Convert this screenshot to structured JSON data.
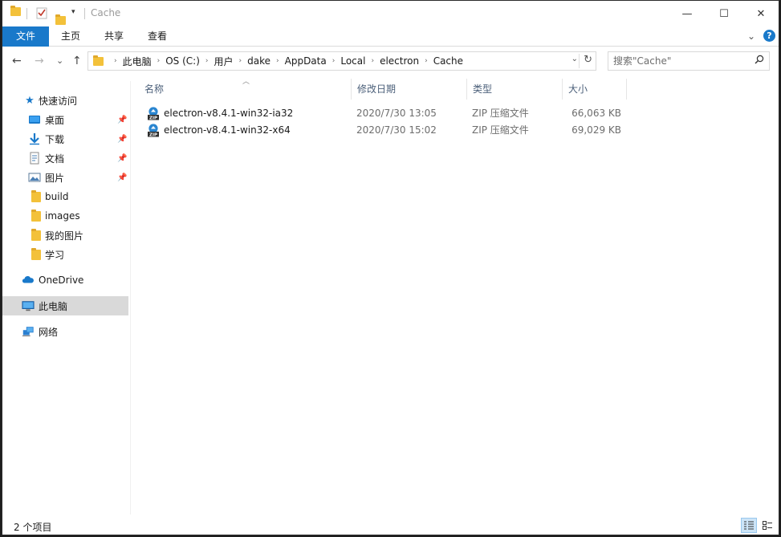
{
  "window": {
    "title": "Cache",
    "minimize": "—",
    "maximize": "☐",
    "close": "✕"
  },
  "ribbon": {
    "tabs": [
      "文件",
      "主页",
      "共享",
      "查看"
    ],
    "help": "?",
    "expand": "⌄"
  },
  "nav": {
    "back": "←",
    "forward": "→",
    "recent": "⌄",
    "up": "↑"
  },
  "address": {
    "crumbs": [
      "此电脑",
      "OS (C:)",
      "用户",
      "dake",
      "AppData",
      "Local",
      "electron",
      "Cache"
    ],
    "dropdown": "⌄",
    "refresh": "↻"
  },
  "search": {
    "placeholder": "搜索\"Cache\""
  },
  "sidebar": {
    "quick_access": "快速访问",
    "items": [
      {
        "label": "桌面",
        "pinned": true
      },
      {
        "label": "下载",
        "pinned": true
      },
      {
        "label": "文档",
        "pinned": true
      },
      {
        "label": "图片",
        "pinned": true
      },
      {
        "label": "build",
        "pinned": false
      },
      {
        "label": "images",
        "pinned": false
      },
      {
        "label": "我的图片",
        "pinned": false
      },
      {
        "label": "学习",
        "pinned": false
      }
    ],
    "onedrive": "OneDrive",
    "this_pc": "此电脑",
    "network": "网络"
  },
  "columns": {
    "name": "名称",
    "date": "修改日期",
    "type": "类型",
    "size": "大小"
  },
  "files": [
    {
      "name": "electron-v8.4.1-win32-ia32",
      "date": "2020/7/30 13:05",
      "type": "ZIP 压缩文件",
      "size": "66,063 KB"
    },
    {
      "name": "electron-v8.4.1-win32-x64",
      "date": "2020/7/30 15:02",
      "type": "ZIP 压缩文件",
      "size": "69,029 KB"
    }
  ],
  "status": {
    "count": "2 个项目"
  },
  "colors": {
    "accent": "#1979ca",
    "folder": "#f3c13a",
    "selected": "#d9d9d9"
  }
}
